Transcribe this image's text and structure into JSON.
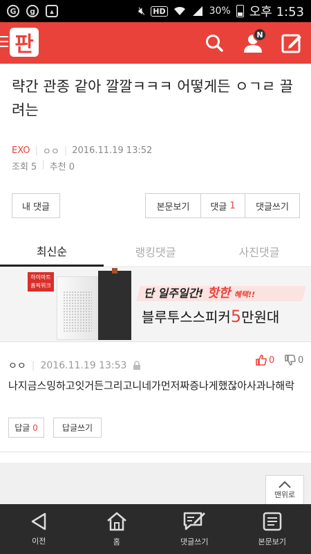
{
  "status_bar": {
    "icons": [
      "gsm-icon",
      "g-icon",
      "image-icon",
      "mute-icon",
      "hd-icon",
      "wifi-icon",
      "signal-icon",
      "battery-icon"
    ],
    "hd_label": "HD",
    "battery": "30%",
    "time": "오후 1:53"
  },
  "header": {
    "logo_text": "판",
    "notification_badge": "N",
    "brand_color": "#e8423a"
  },
  "post": {
    "title": "략간 관종 같아 깔깔ㅋㅋㅋ 어떻게든 ㅇㄱㄹ 끌려는",
    "category": "EXO",
    "author": "ㅇㅇ",
    "date": "2016.11.19 13:52",
    "views_label": "조회 5",
    "likes_label": "추천 0"
  },
  "actions": {
    "my_comments": "내 댓글",
    "view_post": "본문보기",
    "comments_label": "댓글",
    "comments_count": "1",
    "write_comment": "댓글쓰기"
  },
  "tabs": [
    {
      "label": "최신순",
      "active": true
    },
    {
      "label": "랭킹댓글",
      "active": false
    },
    {
      "label": "사진댓글",
      "active": false
    }
  ],
  "ad": {
    "badge": "하이마트 홈픽위크",
    "line1_prefix": "단 일주일간!",
    "line1_hot": "핫한",
    "line1_suffix": "혜택!!",
    "line2_prefix": "블루투스스피커",
    "line2_num": "5",
    "line2_suffix": "만원대"
  },
  "comment": {
    "author": "ㅇㅇ",
    "date": "2016.11.19 13:53",
    "up_count": "0",
    "down_count": "0",
    "text": "나지금스밍하고잇거든그리고니네가먼저짜증나게했잖아사과나해락",
    "reply_label": "답글",
    "reply_count": "0",
    "write_reply": "답글쓰기"
  },
  "scroll_top": {
    "label": "맨위로"
  },
  "bottom_nav": [
    {
      "label": "이전",
      "icon": "back-icon"
    },
    {
      "label": "홈",
      "icon": "home-icon"
    },
    {
      "label": "댓글쓰기",
      "icon": "write-comment-icon"
    },
    {
      "label": "본문보기",
      "icon": "document-icon"
    }
  ]
}
